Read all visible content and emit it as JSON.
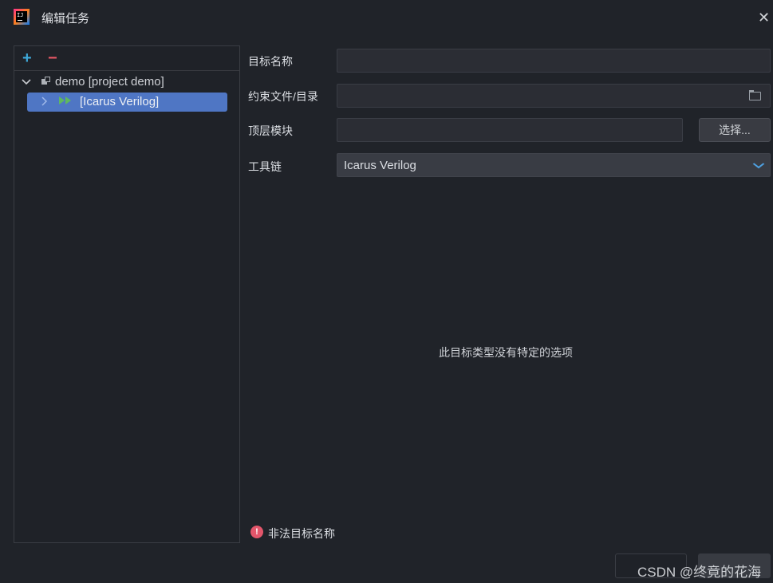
{
  "window": {
    "title": "编辑任务",
    "close_glyph": "✕"
  },
  "tree_toolbar": {
    "add_glyph": "+",
    "remove_glyph": "−"
  },
  "tree": {
    "project_label": "demo [project demo]",
    "target_label": "[Icarus Verilog]"
  },
  "form": {
    "target_name_label": "目标名称",
    "target_name_value": "",
    "constraint_label": "约束文件/目录",
    "constraint_value": "",
    "top_module_label": "顶层模块",
    "top_module_value": "",
    "choose_button": "选择...",
    "toolchain_label": "工具链",
    "toolchain_value": "Icarus Verilog"
  },
  "empty_message": "此目标类型没有特定的选项",
  "error": {
    "icon": "!",
    "text": "非法目标名称"
  },
  "watermark": "CSDN @终竟的花海",
  "colors": {
    "background": "#202329",
    "selection": "#4f76c4",
    "add": "#3ea8d8",
    "remove": "#e55765",
    "run_icon": "#5fb860",
    "error": "#e3566b",
    "dropdown_chevron": "#4ea0e0"
  },
  "icons": {
    "app": "intellij-app-icon",
    "expand": "chevron-down-icon",
    "collapse": "chevron-right-icon",
    "project": "project-icon",
    "run": "run-config-icon",
    "folder": "folder-open-icon",
    "dropdown": "chevron-down-icon",
    "error": "error-icon"
  }
}
